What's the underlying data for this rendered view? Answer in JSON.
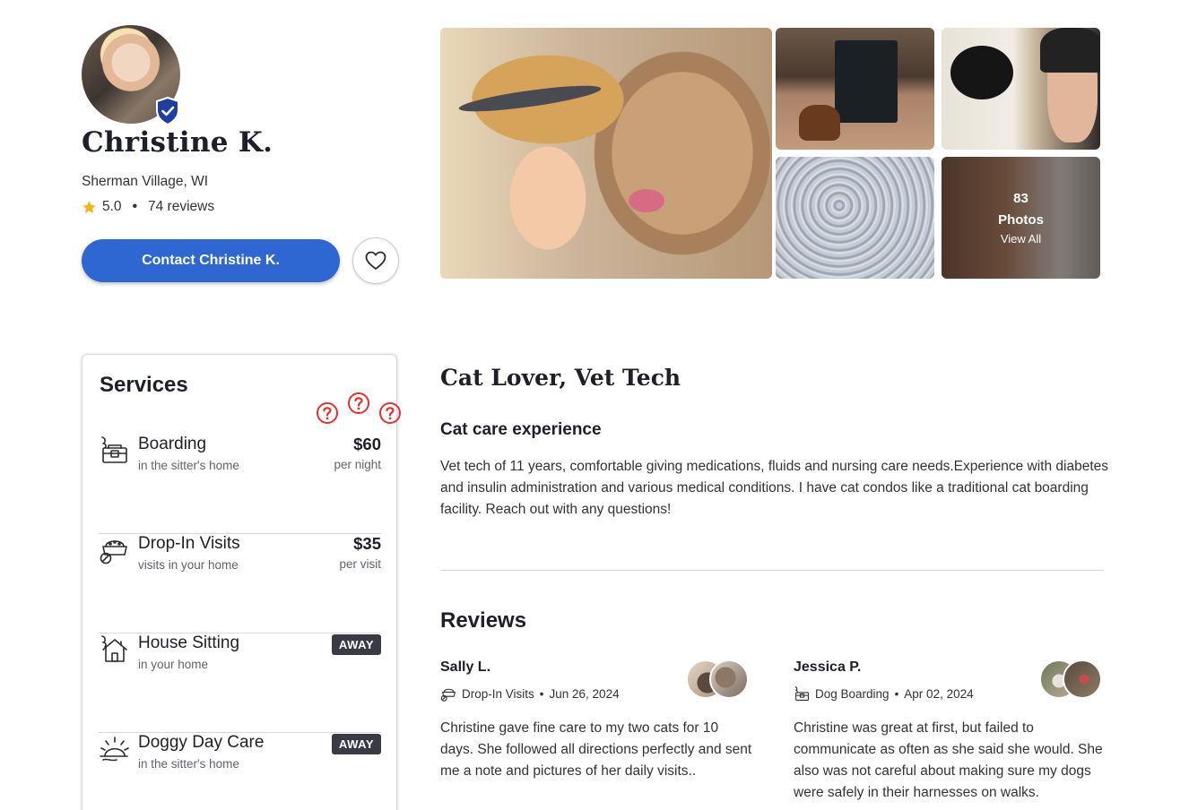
{
  "profile": {
    "name": "Christine K.",
    "location": "Sherman Village, WI",
    "rating": "5.0",
    "reviews_count": "74 reviews",
    "contact_label": "Contact Christine K.",
    "badge_icon": "verified-shield-icon",
    "favorite_icon": "heart-icon"
  },
  "photos": {
    "count": "83",
    "label": "Photos",
    "view_all": "View All"
  },
  "services": {
    "title": "Services",
    "items": [
      {
        "icon": "boarding-icon",
        "name": "Boarding",
        "sub": "in the sitter's home",
        "price": "$60",
        "unit": "per night"
      },
      {
        "icon": "drop-in-icon",
        "name": "Drop-In Visits",
        "sub": "visits in your home",
        "price": "$35",
        "unit": "per visit"
      },
      {
        "icon": "house-sitting-icon",
        "name": "House Sitting",
        "sub": "in your home",
        "badge": "AWAY"
      },
      {
        "icon": "day-care-icon",
        "name": "Doggy Day Care",
        "sub": "in the sitter's home",
        "badge": "AWAY"
      }
    ]
  },
  "about": {
    "headline": "Cat Lover, Vet Tech",
    "subheading": "Cat care experience",
    "bio": "Vet tech of 11 years, comfortable giving medications, fluids and nursing care needs.Experience with diabetes and insulin administration and various medical conditions. I have cat condos like a traditional cat boarding facility. Reach out with any questions!"
  },
  "reviews": {
    "title": "Reviews",
    "items": [
      {
        "name": "Sally L.",
        "service": "Drop-In Visits",
        "date": "Jun 26, 2024",
        "text": "Christine gave fine care to my two cats for 10 days. She followed all directions perfectly and sent me a note and pictures of her daily visits.."
      },
      {
        "name": "Jessica P.",
        "service": "Dog Boarding",
        "date": "Apr 02, 2024",
        "text": "Christine was great at first, but failed to communicate as often as she said she would. She also was not careful about making sure my dogs were safely in their harnesses on walks."
      }
    ]
  },
  "colors": {
    "primary": "#2e67d1",
    "verified": "#1f3f9e",
    "star": "#f5b21a",
    "help": "#e5312b",
    "badge_bg": "#3a3a44"
  }
}
